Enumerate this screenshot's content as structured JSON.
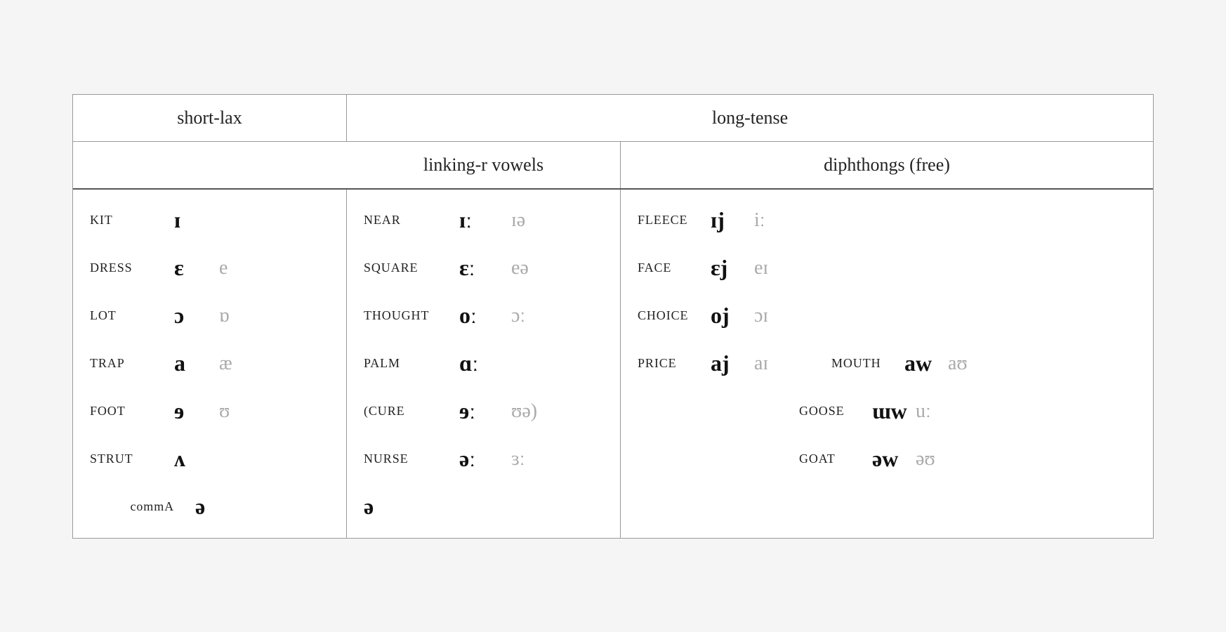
{
  "headers": {
    "short_lax": "short-lax",
    "long_tense": "long-tense",
    "linking_r": "linking-r vowels",
    "diphthongs": "diphthongs (free)"
  },
  "short_lax_rows": [
    {
      "word": "KIT",
      "sym1": "ɪ",
      "sym2": ""
    },
    {
      "word": "DRESS",
      "sym1": "ɛ",
      "sym2": "e"
    },
    {
      "word": "LOT",
      "sym1": "ɔ",
      "sym2": "ɒ"
    },
    {
      "word": "TRAP",
      "sym1": "a",
      "sym2": "æ"
    },
    {
      "word": "FOOT",
      "sym1": "ɘ",
      "sym2": "ʊ"
    },
    {
      "word": "STRUT",
      "sym1": "ʌ",
      "sym2": ""
    },
    {
      "word": "",
      "sym1": "",
      "sym2": "",
      "extra_word": "commA",
      "extra_sym": "ə"
    }
  ],
  "linking_r_rows": [
    {
      "word": "NEAR",
      "sym1": "ɪː",
      "sym2": "ɪə"
    },
    {
      "word": "SQUARE",
      "sym1": "ɛː",
      "sym2": "eə"
    },
    {
      "word": "THOUGHT",
      "sym1": "oː",
      "sym2": "ɔː"
    },
    {
      "word": "PALM",
      "sym1": "ɑː",
      "sym2": ""
    },
    {
      "word": "(CURE",
      "sym1": "ɘː",
      "sym2": "ʊə)"
    },
    {
      "word": "NURSE",
      "sym1": "əː",
      "sym2": "ɜː"
    },
    {
      "word": "",
      "sym1": "ə",
      "sym2": ""
    }
  ],
  "diphthong_rows": [
    {
      "groups": [
        {
          "word": "FLEECE",
          "sym1": "ɪj",
          "sym2": "iː"
        }
      ]
    },
    {
      "groups": [
        {
          "word": "FACE",
          "sym1": "ɛj",
          "sym2": "eɪ"
        }
      ]
    },
    {
      "groups": [
        {
          "word": "CHOICE",
          "sym1": "oj",
          "sym2": "ɔɪ"
        }
      ]
    },
    {
      "groups": [
        {
          "word": "PRICE",
          "sym1": "aj",
          "sym2": "aɪ"
        },
        {
          "word": "MOUTH",
          "sym1": "aw",
          "sym2": "aʊ"
        }
      ]
    },
    {
      "groups": [
        {
          "word": "",
          "sym1": "",
          "sym2": ""
        },
        {
          "word": "GOOSE",
          "sym1": "ɯw",
          "sym2": "uː"
        }
      ]
    },
    {
      "groups": [
        {
          "word": "",
          "sym1": "",
          "sym2": ""
        },
        {
          "word": "GOAT",
          "sym1": "əw",
          "sym2": "əʊ"
        }
      ]
    },
    {
      "groups": []
    }
  ]
}
